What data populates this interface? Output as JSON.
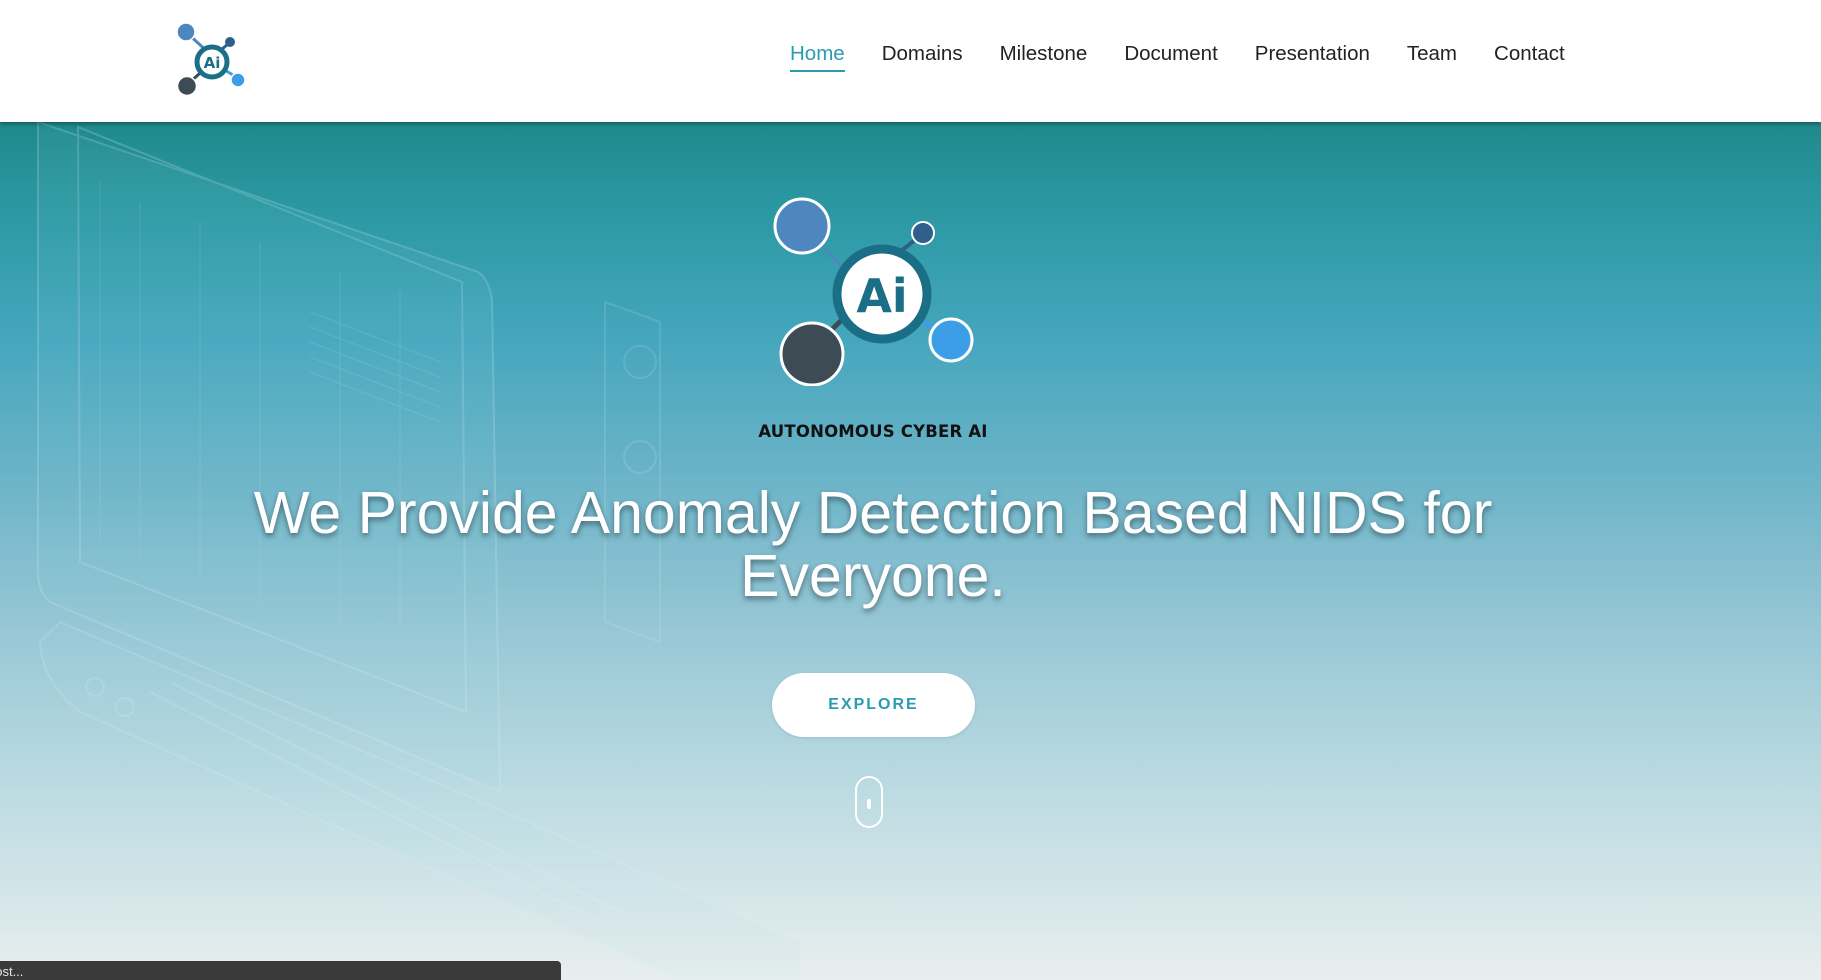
{
  "header": {
    "logo_icon": "ai-molecule-logo",
    "nav_items": [
      {
        "label": "Home",
        "active": true
      },
      {
        "label": "Domains",
        "active": false
      },
      {
        "label": "Milestone",
        "active": false
      },
      {
        "label": "Document",
        "active": false
      },
      {
        "label": "Presentation",
        "active": false
      },
      {
        "label": "Team",
        "active": false
      },
      {
        "label": "Contact",
        "active": false
      }
    ]
  },
  "hero": {
    "logo_text": "Ai",
    "logo_caption": "AUTONOMOUS CYBER AI",
    "headline": "We Provide Anomaly Detection Based NIDS for Everyone.",
    "cta_label": "EXPLORE",
    "scroll_icon": "mouse-scroll-icon"
  },
  "status_bar": {
    "text": "host..."
  },
  "colors": {
    "accent": "#2a9bb3",
    "nav_text": "#222222",
    "hero_top": "#1f8a8c",
    "hero_bottom": "#e8eeee",
    "logo_ring": "#1a6e86",
    "node_blue": "#4e86bf",
    "node_light_blue": "#3b9ee6",
    "node_dark": "#3d4b55"
  }
}
